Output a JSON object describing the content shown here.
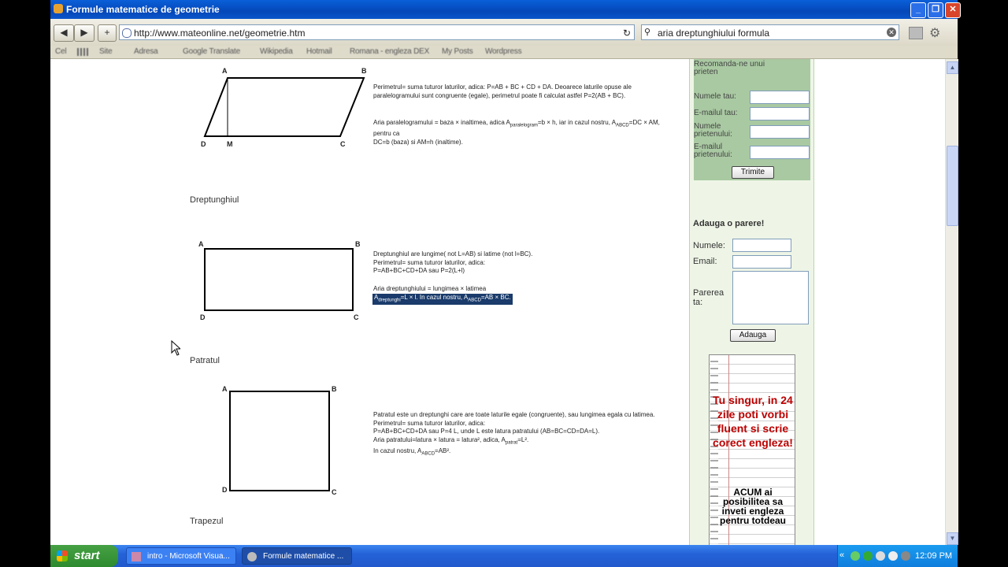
{
  "window": {
    "title": "Formule matematice de geometrie"
  },
  "nav": {
    "back": "◀",
    "forward": "▶",
    "new_tab": "+",
    "url": "http://www.mateonline.net/geometrie.htm",
    "search_value": "aria dreptunghiului formula"
  },
  "bookmarks": [
    "Cel",
    "Site",
    "Adresa",
    "Google Translate",
    "Wikipedia",
    "Hotmail",
    "Romana - engleza DEX",
    "My Posts",
    "Wordpress"
  ],
  "page": {
    "parallelogram": {
      "labels": {
        "a": "A",
        "b": "B",
        "c": "C",
        "d": "D",
        "m": "M"
      },
      "perimeter_text": "Perimetrul= suma tuturor laturilor, adica: P=AB + BC + CD + DA. Deoarece laturile opuse ale paralelogramului sunt congruente (egale), perimetrul poate fi calculat astfel P=2(AB + BC).",
      "area_line1": "Aria paralelogramului = baza × inaltimea, adica A",
      "area_sub1": "paralelogram",
      "area_line1b": "=b × h, iar in cazul nostru, A",
      "area_sub2": "ABCD",
      "area_line1c": "=DC × AM, pentru ca",
      "area_line2": "DC=b (baza) si AM=h (inaltime)."
    },
    "rectangle": {
      "heading": "Dreptunghiul",
      "labels": {
        "a": "A",
        "b": "B",
        "c": "C",
        "d": "D"
      },
      "text1": "Dreptunghiul are lungime( not L=AB) si latime (not l=BC).",
      "text2": "Perimetrul= suma tuturor laturilor, adica:",
      "text3": "P=AB+BC+CD+DA sau P=2(L+l)",
      "area_text": "Aria dreptunghiului = lungimea × latimea",
      "hl_a": "A",
      "hl_sub1": "dreptunghi",
      "hl_mid": "=L × l. In cazul nostru, A",
      "hl_sub2": "ABCD",
      "hl_end": "=AB × BC."
    },
    "square": {
      "heading": "Patratul",
      "labels": {
        "a": "A",
        "b": "B",
        "c": "C",
        "d": "D"
      },
      "text1": "Patratul este un dreptunghi care are toate laturile egale (congruente), sau lungimea egala cu latimea.",
      "text2": "Perimetrul= suma tuturor laturilor, adica:",
      "text3": "P=AB+BC+CD+DA sau P=4 L, unde L este latura patratului (AB=BC=CD=DA=L).",
      "text4": "Aria patratului=latura × latura = latura², adica, A",
      "text4_sub": "patrat",
      "text4_end": "=L².",
      "text5": "In cazul nostru, A",
      "text5_sub": "ABCD",
      "text5_end": "=AB²."
    },
    "trapezoid": {
      "heading": "Trapezul"
    }
  },
  "sidebar": {
    "recommend": {
      "title": "Recomanda-ne unui prieten",
      "name_label": "Numele tau:",
      "email_label": "E-mailul tau:",
      "friend_name_label": "Numele prietenului:",
      "friend_email_label": "E-mailul prietenului:",
      "send_button": "Trimite"
    },
    "opinion": {
      "title": "Adauga o parere!",
      "name_label": "Numele:",
      "email_label": "Email:",
      "opinion_label": "Parerea ta:",
      "add_button": "Adauga"
    },
    "ad": {
      "line1": "Tu singur, in 24 zile poti vorbi fluent si scrie corect engleza!",
      "line2": "ACUM ai posibilitea sa inveti engleza pentru totdeau"
    }
  },
  "taskbar": {
    "start": "start",
    "tasks": [
      "intro - Microsoft Visua...",
      "Formule matematice ..."
    ],
    "clock": "12:09 PM"
  }
}
